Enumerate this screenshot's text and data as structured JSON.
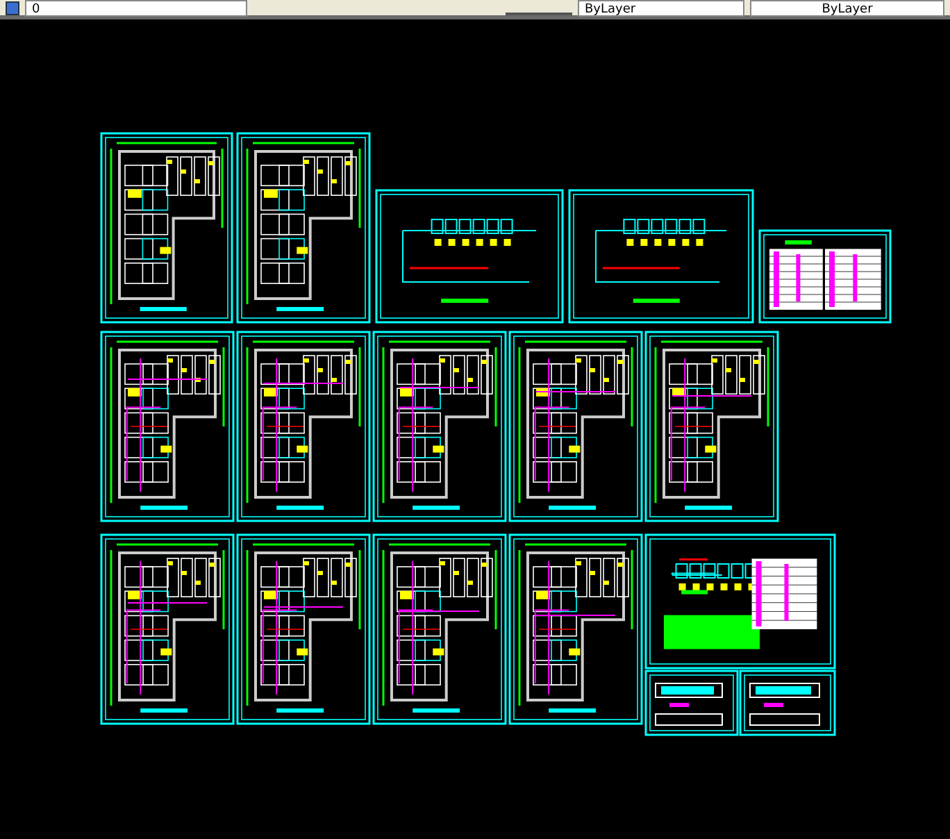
{
  "toolbar": {
    "layer": "0",
    "color_control": "ByLayer",
    "linetype_control": "ByLayer"
  },
  "sheets": [
    {
      "kind": "floor-plan"
    },
    {
      "kind": "floor-plan"
    },
    {
      "kind": "schematic"
    },
    {
      "kind": "schematic"
    },
    {
      "kind": "table"
    },
    {
      "kind": "piping-plan"
    },
    {
      "kind": "piping-plan"
    },
    {
      "kind": "piping-plan"
    },
    {
      "kind": "piping-plan"
    },
    {
      "kind": "piping-plan"
    },
    {
      "kind": "piping-plan"
    },
    {
      "kind": "piping-plan"
    },
    {
      "kind": "piping-plan"
    },
    {
      "kind": "piping-plan"
    },
    {
      "kind": "legend"
    },
    {
      "kind": "detail"
    },
    {
      "kind": "detail"
    }
  ]
}
